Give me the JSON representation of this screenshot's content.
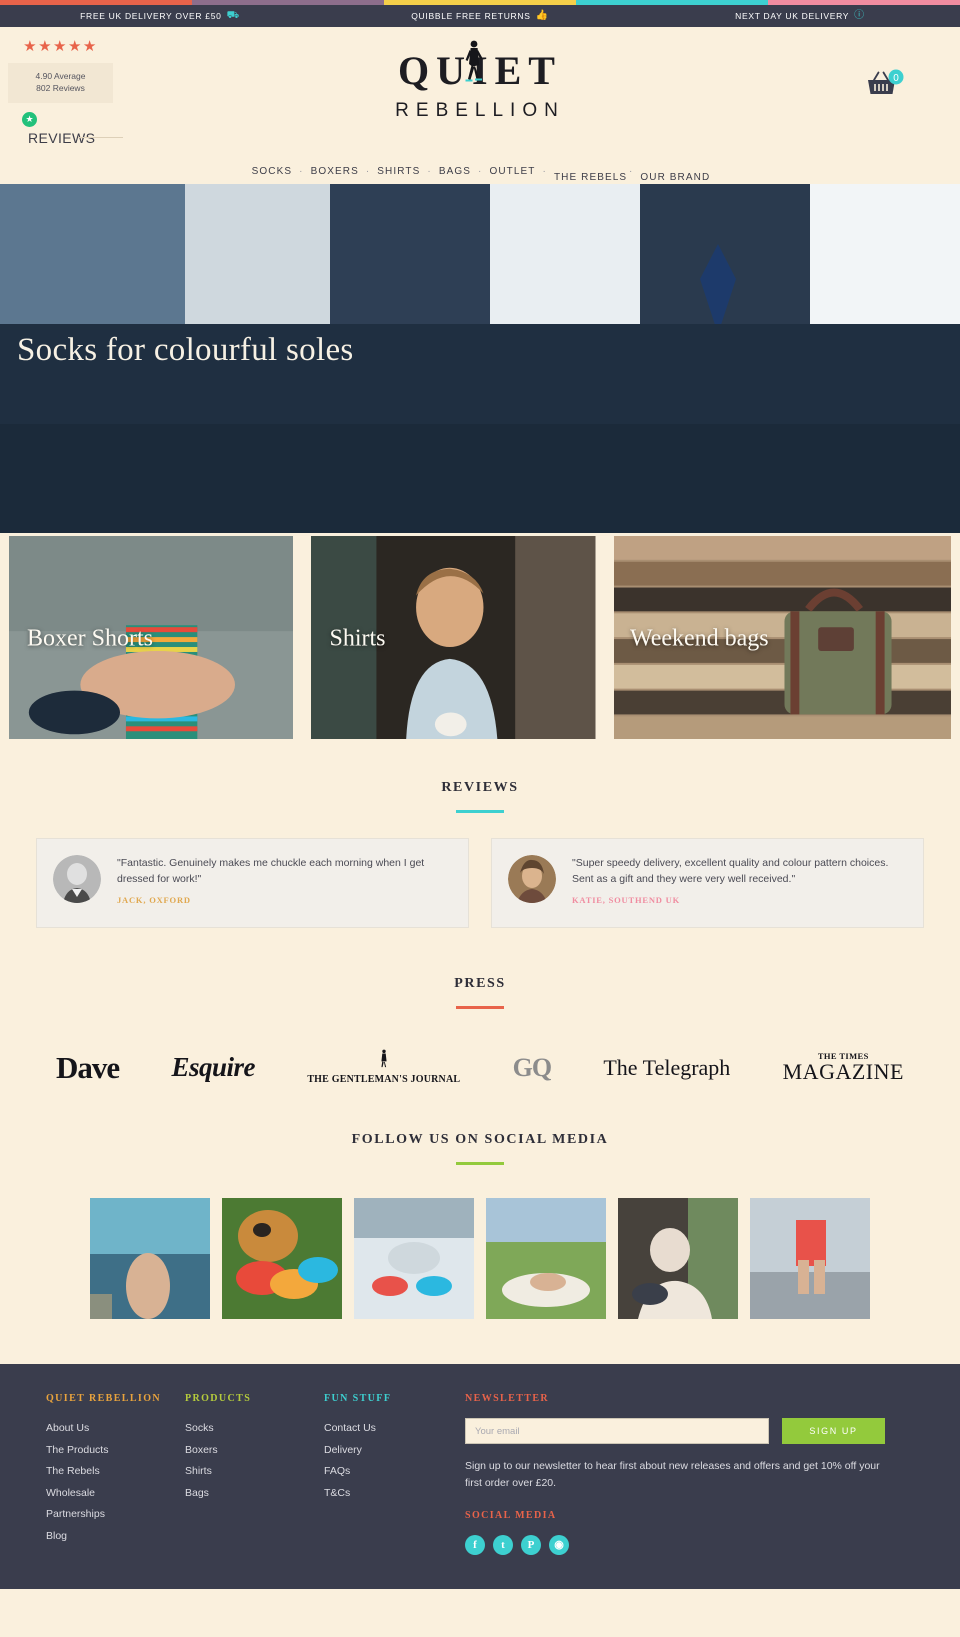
{
  "promo_stripes": [
    "#e8634a",
    "#8d6e8c",
    "#f5cf4a",
    "#3dd0d0",
    "#f08ca0"
  ],
  "promo_bar": {
    "items": [
      {
        "text": "FREE UK DELIVERY OVER £50",
        "icon": "truck-icon",
        "glyph": "⛟"
      },
      {
        "text": "QUIBBLE FREE RETURNS",
        "icon": "thumbs-up-icon",
        "glyph": "👍"
      },
      {
        "text": "NEXT DAY UK DELIVERY",
        "icon": "clock-icon",
        "glyph": "ⓘ"
      }
    ]
  },
  "reviews_widget": {
    "stars": "★★★★★",
    "average": "4.90 Average",
    "count": "802 Reviews",
    "badge_glyph": "★",
    "label": "REVIEWS"
  },
  "logo": {
    "top": "QUIET",
    "bottom": "REBELLION"
  },
  "basket": {
    "count": "0",
    "icon": "shopping-basket-icon"
  },
  "nav": {
    "inline": [
      "SOCKS",
      "BOXERS",
      "SHIRTS",
      "BAGS",
      "OUTLET"
    ],
    "separator": "·",
    "stacked": [
      "THE REBELS",
      "OUR BRAND"
    ]
  },
  "hero": {
    "title": "Socks for colourful soles"
  },
  "tiles": [
    {
      "label": "Boxer Shorts",
      "name": "tile-boxer-shorts"
    },
    {
      "label": "Shirts",
      "name": "tile-shirts"
    },
    {
      "label": "Weekend bags",
      "name": "tile-weekend-bags"
    }
  ],
  "reviews_section": {
    "title": "REVIEWS",
    "rule_color": "#3dd0d0",
    "cards": [
      {
        "quote": "\"Fantastic. Genuinely makes me chuckle each morning when I get dressed for work!\"",
        "author": "JACK, OXFORD",
        "author_color": "#e0a850"
      },
      {
        "quote": "\"Super speedy delivery, excellent quality and colour pattern choices. Sent as a gift and they were very well received.\"",
        "author": "KATIE, SOUTHEND UK",
        "author_color": "#f08ca0"
      }
    ]
  },
  "press_section": {
    "title": "PRESS",
    "rule_color": "#e8634a",
    "logos": [
      {
        "name": "press-logo-dave",
        "text": "Dave"
      },
      {
        "name": "press-logo-esquire",
        "text": "Esquire"
      },
      {
        "name": "press-logo-gentlemans-journal",
        "text": "THE GENTLEMAN'S JOURNAL"
      },
      {
        "name": "press-logo-gq",
        "text": "GQ"
      },
      {
        "name": "press-logo-telegraph",
        "text": "The Telegraph"
      },
      {
        "name": "press-logo-times-magazine",
        "text_top": "THE TIMES",
        "text_main": "MAGAZINE"
      }
    ]
  },
  "social_section": {
    "title": "FOLLOW US ON SOCIAL MEDIA",
    "rule_color": "#93ca3c",
    "tiles": [
      {
        "name": "social-post-1"
      },
      {
        "name": "social-post-2"
      },
      {
        "name": "social-post-3"
      },
      {
        "name": "social-post-4"
      },
      {
        "name": "social-post-5"
      },
      {
        "name": "social-post-6"
      }
    ]
  },
  "footer": {
    "columns": [
      {
        "heading": "QUIET REBELLION",
        "heading_color": "#e8a33d",
        "links": [
          "About Us",
          "The Products",
          "The Rebels",
          "Wholesale",
          "Partnerships",
          "Blog"
        ]
      },
      {
        "heading": "PRODUCTS",
        "heading_color": "#b5cc3c",
        "links": [
          "Socks",
          "Boxers",
          "Shirts",
          "Bags"
        ]
      },
      {
        "heading": "FUN STUFF",
        "heading_color": "#3dd0d0",
        "links": [
          "Contact Us",
          "Delivery",
          "FAQs",
          "T&Cs"
        ]
      }
    ],
    "newsletter": {
      "heading": "NEWSLETTER",
      "heading_color": "#e8634a",
      "placeholder": "Your email",
      "value": "",
      "button": "SIGN UP",
      "copy": "Sign up to our newsletter to hear first about new releases and offers and get 10% off your first order over £20."
    },
    "social": {
      "heading": "SOCIAL MEDIA",
      "heading_color": "#e8634a",
      "icons": [
        {
          "name": "facebook-icon",
          "glyph": "f",
          "color": "#3dd0d0"
        },
        {
          "name": "twitter-icon",
          "glyph": "t",
          "color": "#3dd0d0"
        },
        {
          "name": "pinterest-icon",
          "glyph": "P",
          "color": "#3dd0d0"
        },
        {
          "name": "instagram-icon",
          "glyph": "◉",
          "color": "#3dd0d0"
        }
      ]
    }
  }
}
